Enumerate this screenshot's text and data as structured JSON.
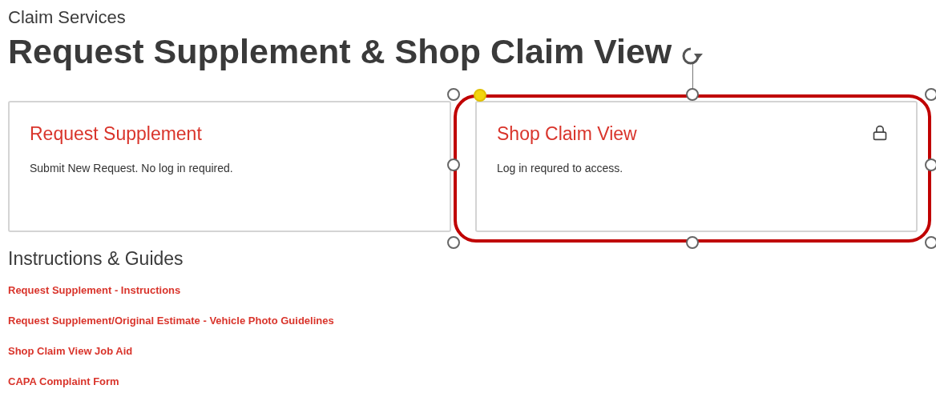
{
  "eyebrow": "Claim Services",
  "title": "Request Supplement & Shop Claim View",
  "cards": [
    {
      "title": "Request Supplement",
      "description": "Submit New Request. No log in required.",
      "locked": false,
      "highlighted": false
    },
    {
      "title": "Shop Claim View",
      "description": "Log in requred to access.",
      "locked": true,
      "highlighted": true
    }
  ],
  "guides": {
    "heading": "Instructions & Guides",
    "links": [
      "Request Supplement - Instructions",
      "Request Supplement/Original Estimate - Vehicle Photo Guidelines",
      "Shop Claim View Job Aid",
      "CAPA Complaint Form"
    ]
  }
}
